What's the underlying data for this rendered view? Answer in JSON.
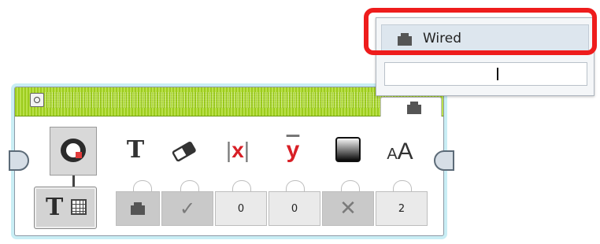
{
  "dropdown": {
    "selected_label": "Wired",
    "input_value": ""
  },
  "parameters": {
    "icons": [
      "text-icon",
      "eraser-icon",
      "x-position-icon",
      "y-position-icon",
      "color-icon",
      "font-size-icon"
    ],
    "x_icon_text": "x",
    "y_icon_text": "y",
    "text_icon_glyph": "T",
    "font_icon_small": "A",
    "font_icon_large": "A",
    "values": {
      "x": "0",
      "y": "0",
      "font": "2"
    },
    "clear_screen_glyph": "✓",
    "color_glyph": "✕"
  },
  "mode": {
    "glyph": "T"
  },
  "colors": {
    "title_green": "#a9d531",
    "highlight_red": "#ee1c1c",
    "icon_red": "#d81f26",
    "connector_blue": "#2aa7c9"
  }
}
